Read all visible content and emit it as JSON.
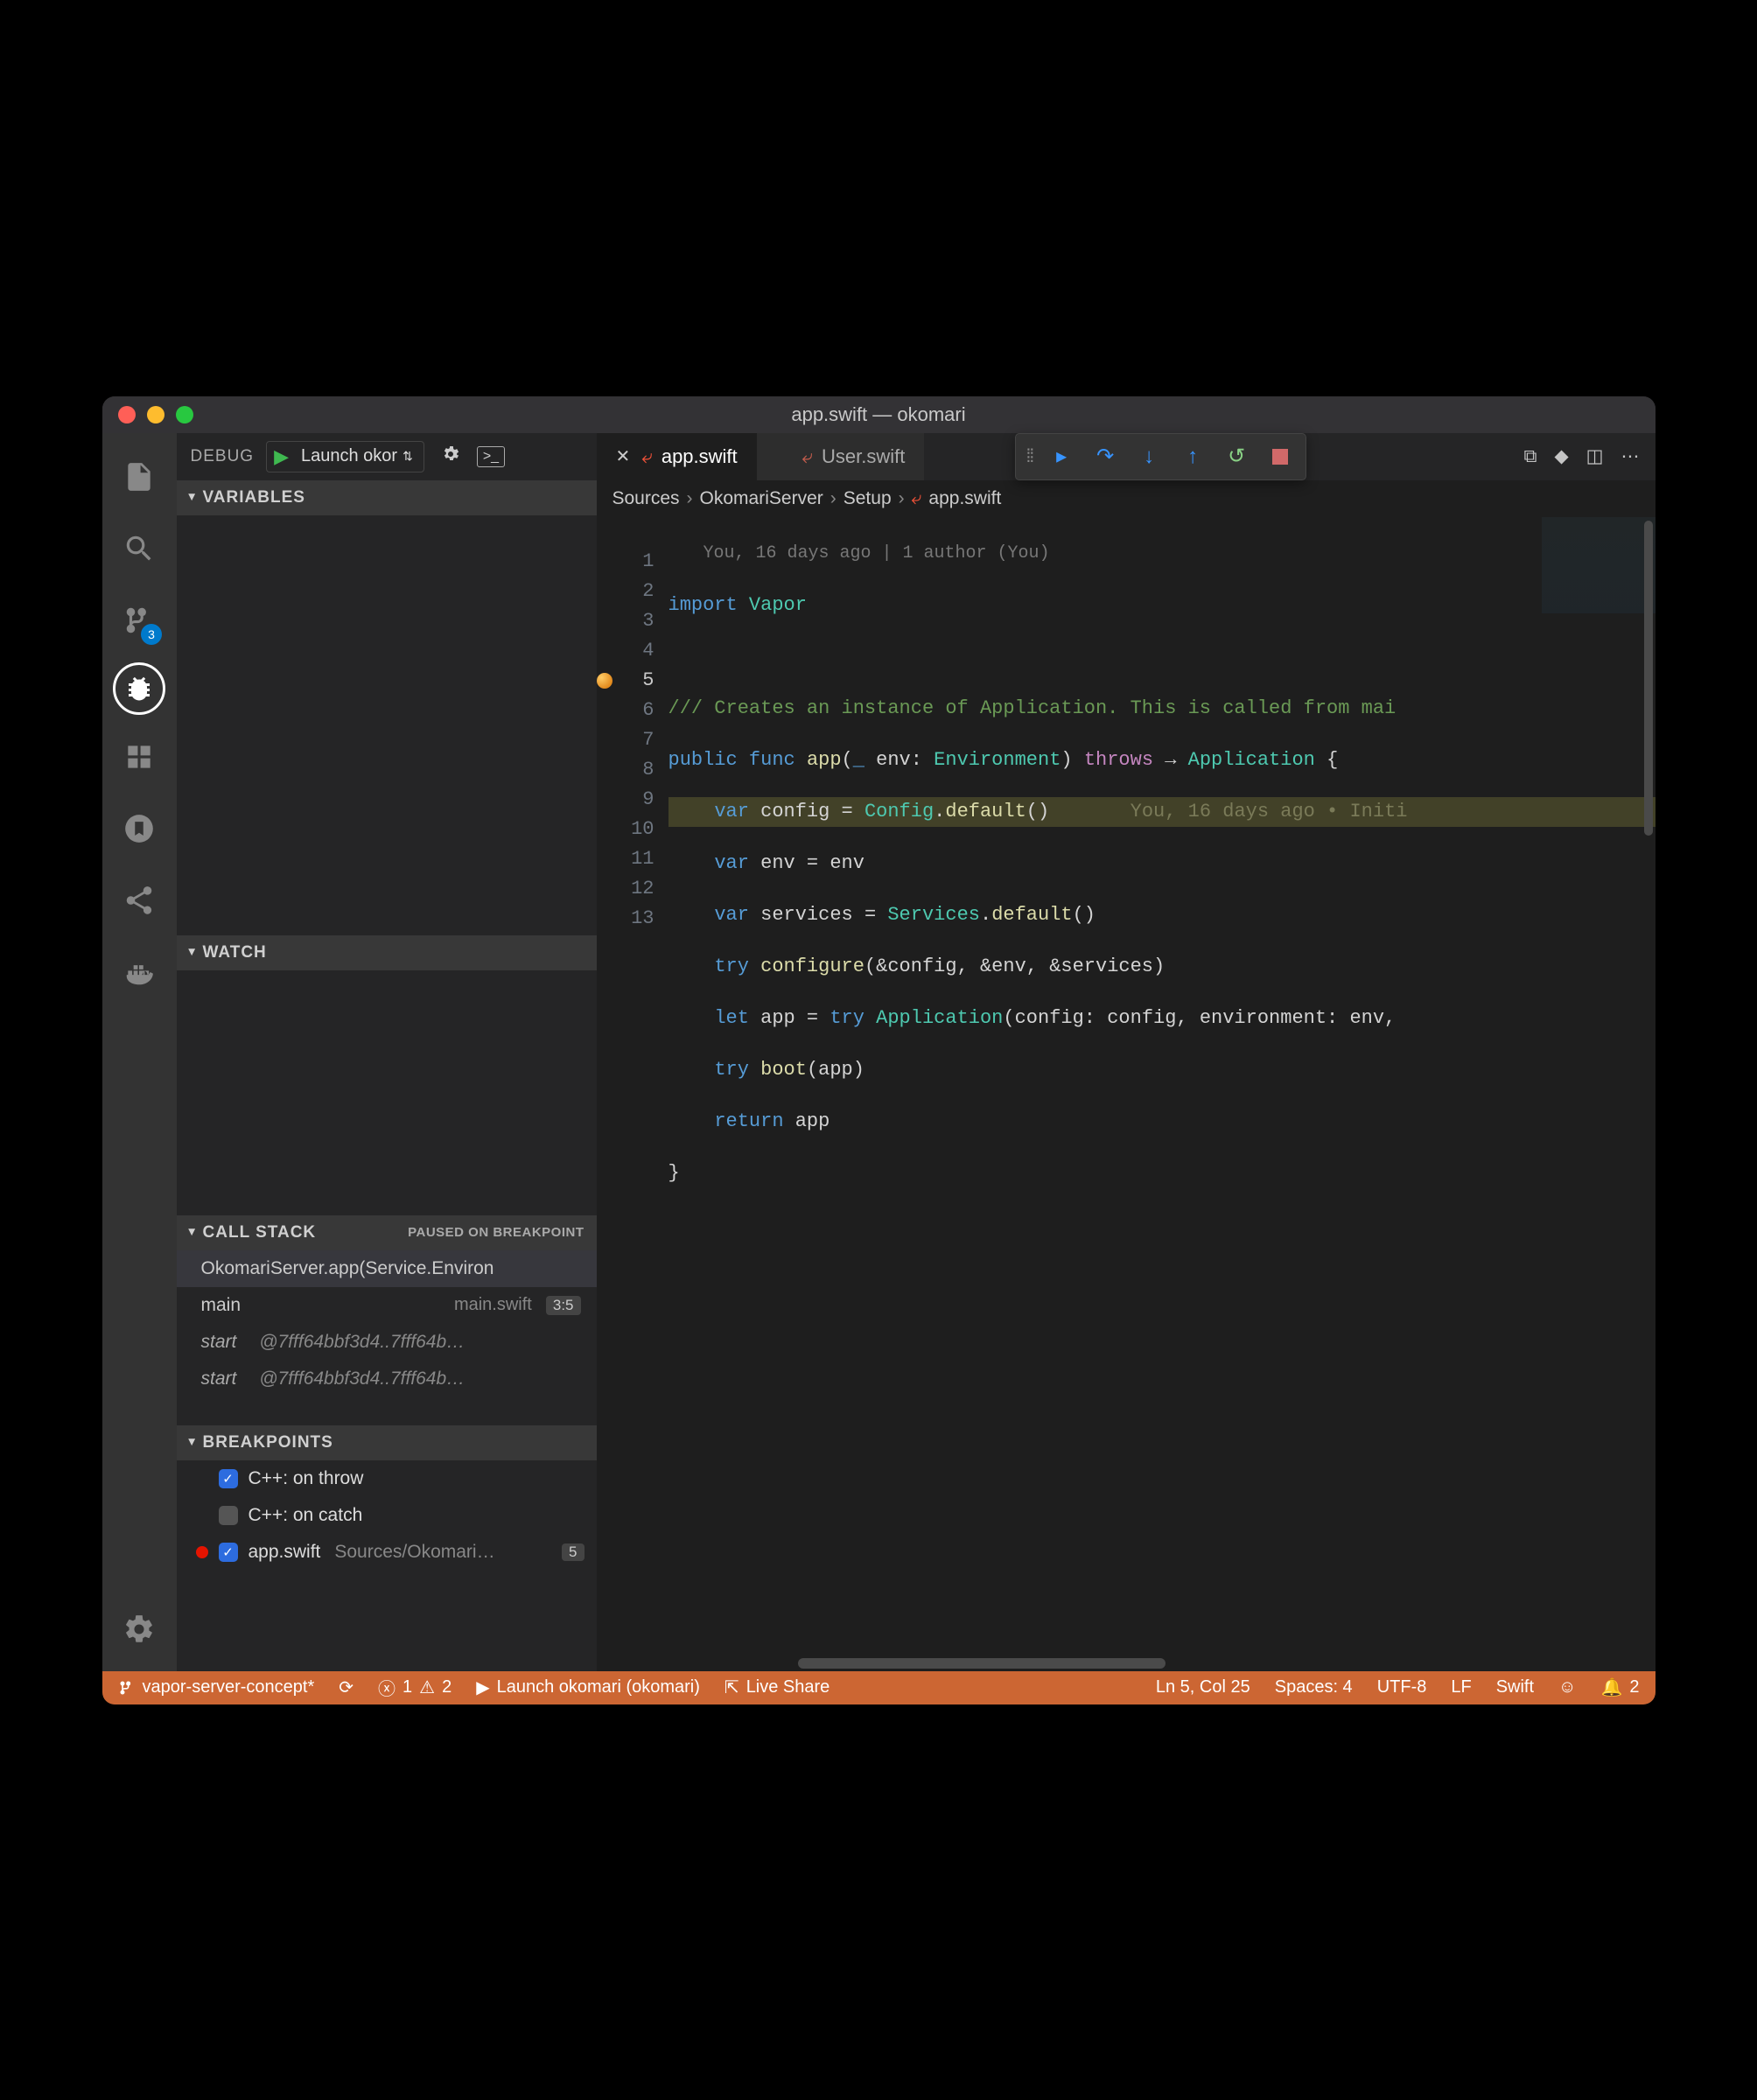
{
  "window": {
    "title": "app.swift — okomari"
  },
  "activity": {
    "scm_badge": "3"
  },
  "debug": {
    "label": "DEBUG",
    "config": "Launch okor",
    "sections": {
      "variables": "VARIABLES",
      "watch": "WATCH",
      "callstack": "CALL STACK",
      "callstack_state": "PAUSED ON BREAKPOINT",
      "breakpoints": "BREAKPOINTS"
    },
    "stack": [
      {
        "fn": "OkomariServer.app(Service.Environ",
        "file": "",
        "pos": ""
      },
      {
        "fn": "main",
        "file": "main.swift",
        "pos": "3:5"
      },
      {
        "fn": "start",
        "addr": "@7fff64bbf3d4..7fff64b…"
      },
      {
        "fn": "start",
        "addr": "@7fff64bbf3d4..7fff64b…"
      }
    ],
    "bps": [
      {
        "on": true,
        "label": "C++: on throw"
      },
      {
        "on": false,
        "label": "C++: on catch"
      },
      {
        "on": true,
        "label": "app.swift",
        "path": "Sources/Okomari…",
        "cnt": "5",
        "dot": true
      }
    ]
  },
  "tabs": [
    {
      "name": "app.swift",
      "active": true,
      "close": true
    },
    {
      "name": "User.swift",
      "active": false,
      "close": false
    }
  ],
  "breadcrumb": [
    "Sources",
    "OkomariServer",
    "Setup",
    "app.swift"
  ],
  "codelens": "You, 16 days ago | 1 author (You)",
  "inlineblame": "You, 16 days ago • Initi",
  "code": {
    "lines": [
      {
        "n": 1,
        "t": "import Vapor"
      },
      {
        "n": 2,
        "t": ""
      },
      {
        "n": 3,
        "t": "/// Creates an instance of Application. This is called from mai"
      },
      {
        "n": 4,
        "t": "public func app(_ env: Environment) throws → Application {"
      },
      {
        "n": 5,
        "t": "    var config = Config.default()",
        "hl": true
      },
      {
        "n": 6,
        "t": "    var env = env"
      },
      {
        "n": 7,
        "t": "    var services = Services.default()"
      },
      {
        "n": 8,
        "t": "    try configure(&config, &env, &services)"
      },
      {
        "n": 9,
        "t": "    let app = try Application(config: config, environment: env,"
      },
      {
        "n": 10,
        "t": "    try boot(app)"
      },
      {
        "n": 11,
        "t": "    return app"
      },
      {
        "n": 12,
        "t": "}"
      },
      {
        "n": 13,
        "t": ""
      }
    ]
  },
  "status": {
    "branch": "vapor-server-concept*",
    "errors": "1",
    "warnings": "2",
    "launch": "Launch okomari (okomari)",
    "liveshare": "Live Share",
    "pos": "Ln 5, Col 25",
    "spaces": "Spaces: 4",
    "encoding": "UTF-8",
    "eol": "LF",
    "lang": "Swift",
    "bell": "2"
  }
}
